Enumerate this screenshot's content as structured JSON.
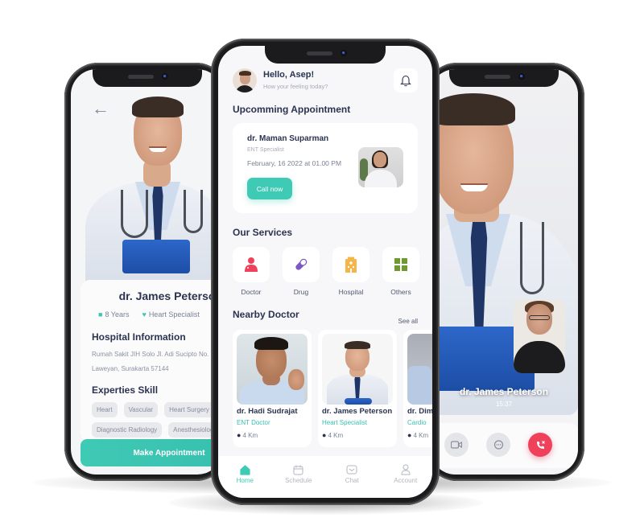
{
  "left_screen": {
    "back_icon": "arrow-left-icon",
    "doctor_name": "dr. James Peterson",
    "experience": "8 Years",
    "experience_icon": "briefcase-icon",
    "specialty": "Heart Specialist",
    "specialty_icon": "heart-icon",
    "hospital_title": "Hospital Information",
    "address_line1": "Rumah Sakit JIH Solo Jl. Adi Sucipto No.",
    "address_line2": "Laweyan, Surakarta 57144",
    "skills_title": "Experties Skill",
    "skills": [
      "Heart",
      "Vascular",
      "Heart Surgery",
      "Diagnostic Radiology",
      "Anesthesiology"
    ],
    "make_appointment_label": "Make Appointment"
  },
  "center_screen": {
    "greeting": "Hello, Asep!",
    "subtitle": "How your feeling today?",
    "bell_icon": "bell-icon",
    "upcoming_title": "Upcomming Appointment",
    "appointment": {
      "doctor": "dr. Maman Suparman",
      "specialty": "ENT Specialist",
      "datetime": "February, 16 2022 at 01.00 PM",
      "call_label": "Call now"
    },
    "services_title": "Our Services",
    "services": [
      {
        "label": "Doctor",
        "icon": "doctor-icon",
        "color": "#f0415b"
      },
      {
        "label": "Drug",
        "icon": "pill-icon",
        "color": "#7b58c2"
      },
      {
        "label": "Hospital",
        "icon": "hospital-icon",
        "color": "#f5b549"
      },
      {
        "label": "Others",
        "icon": "grid-icon",
        "color": "#6f9a2e"
      }
    ],
    "nearby_title": "Nearby Doctor",
    "see_all_label": "See all",
    "nearby_doctors": [
      {
        "name": "dr. Hadi Sudrajat",
        "specialty": "ENT Doctor",
        "distance": "4 Km"
      },
      {
        "name": "dr. James Peterson",
        "specialty": "Heart Specialist",
        "distance": "4 Km"
      },
      {
        "name": "dr. Dim",
        "specialty": "Cardio",
        "distance": "4 Km"
      }
    ],
    "tabs": [
      {
        "label": "Home",
        "icon": "home-icon",
        "active": true
      },
      {
        "label": "Schedule",
        "icon": "calendar-icon",
        "active": false
      },
      {
        "label": "Chat",
        "icon": "chat-icon",
        "active": false
      },
      {
        "label": "Account",
        "icon": "user-icon",
        "active": false
      }
    ]
  },
  "right_screen": {
    "caller_name": "dr. James Peterson",
    "call_duration": "15:37",
    "controls": [
      {
        "name": "video",
        "icon": "video-camera-icon"
      },
      {
        "name": "chat",
        "icon": "chat-bubble-icon"
      },
      {
        "name": "end-call",
        "icon": "end-call-icon"
      }
    ]
  },
  "colors": {
    "accent": "#3fcab5",
    "text_dark": "#2b3350",
    "end_call": "#f0415b"
  }
}
